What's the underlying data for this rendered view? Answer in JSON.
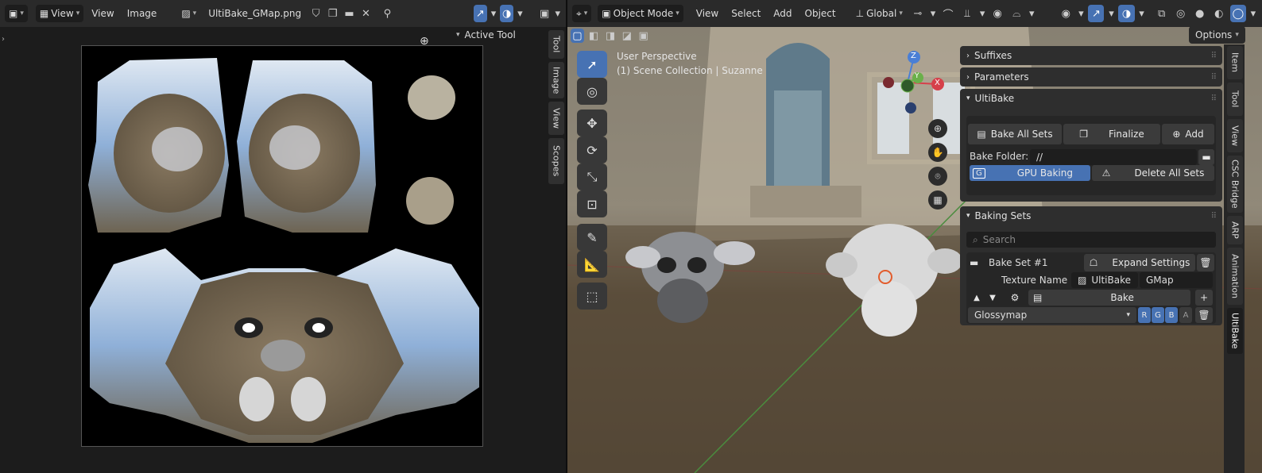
{
  "image_editor": {
    "view_menu_dropdown": "View",
    "menu_view": "View",
    "menu_image": "Image",
    "image_name": "UltiBake_GMap.png",
    "active_tool_label": "Active Tool",
    "side_tabs": [
      "Tool",
      "Image",
      "View",
      "Scopes"
    ]
  },
  "viewport": {
    "mode": "Object Mode",
    "menu": [
      "View",
      "Select",
      "Add",
      "Object"
    ],
    "transform_orientation": "Global",
    "options_label": "Options",
    "perspective_label": "User Perspective",
    "collection_label": "(1) Scene Collection | Suzanne",
    "gizmo": {
      "x": "X",
      "y": "Y",
      "z": "Z"
    },
    "side_tabs": [
      "Item",
      "Tool",
      "View",
      "CSC Bridge",
      "ARP",
      "Animation",
      "UltiBake"
    ]
  },
  "sidebar": {
    "suffixes": "Suffixes",
    "parameters": "Parameters",
    "ultibake": {
      "title": "UltiBake",
      "bake_all_sets": "Bake All Sets",
      "finalize": "Finalize",
      "add": "Add",
      "bake_folder_label": "Bake Folder:",
      "bake_folder_value": "//",
      "gpu_baking": "GPU Baking",
      "gpu_key": "G",
      "delete_all_sets": "Delete All Sets"
    },
    "baking_sets": {
      "title": "Baking Sets",
      "search_placeholder": "Search",
      "set_name": "Bake Set #1",
      "expand_settings": "Expand Settings",
      "texture_name_label": "Texture Name :",
      "texture_prefix": "UltiBake",
      "texture_suffix": "GMap",
      "bake": "Bake",
      "map_type": "Glossymap",
      "channels": [
        "R",
        "G",
        "B",
        "A"
      ]
    }
  },
  "colors": {
    "accent": "#4772b3",
    "header": "#2a2a2a",
    "panel": "#2e2e2e"
  }
}
